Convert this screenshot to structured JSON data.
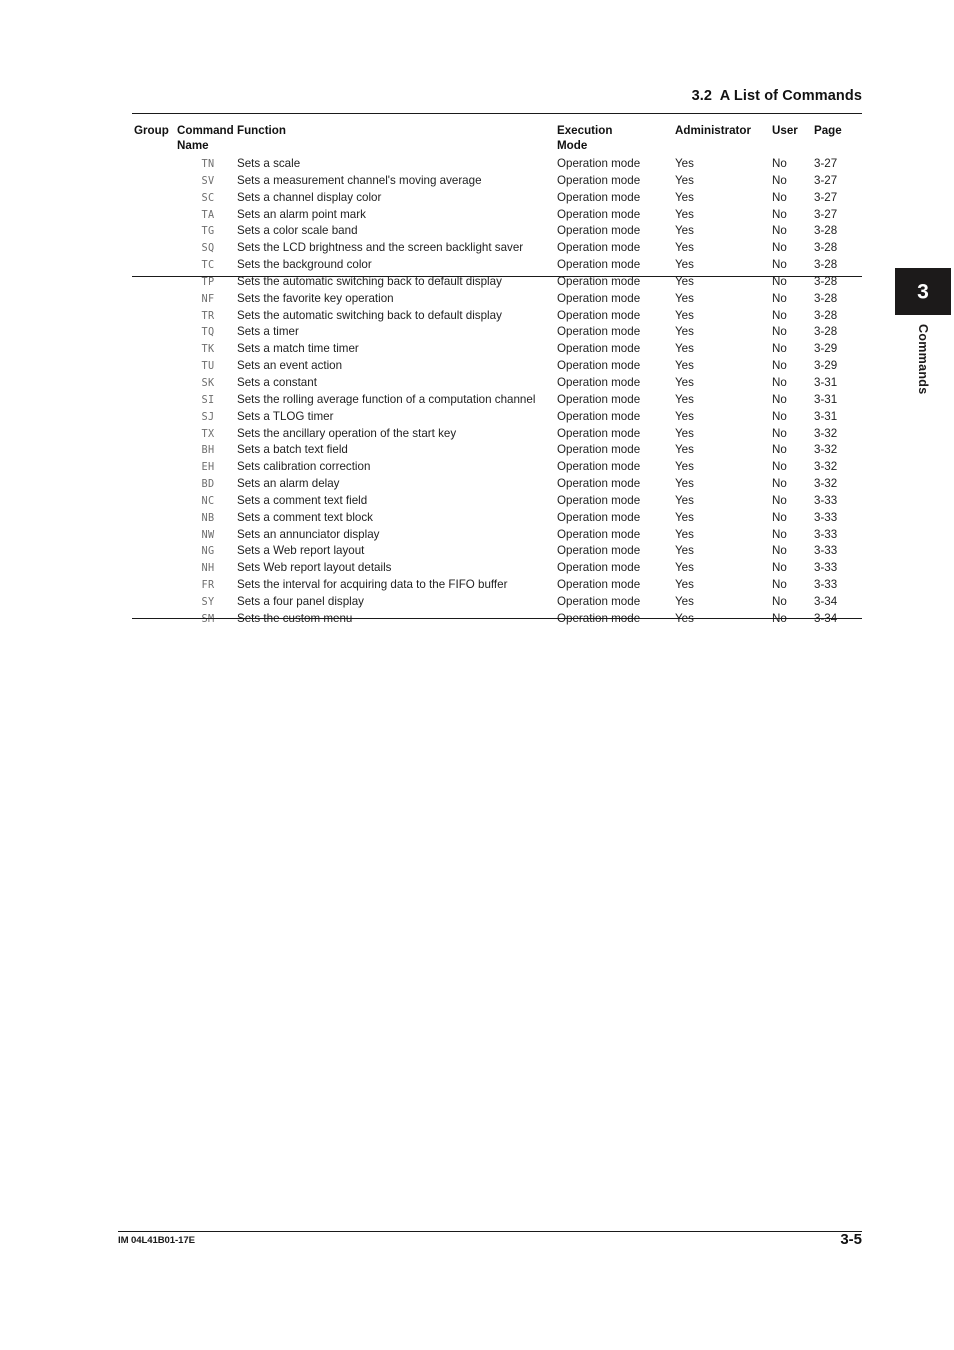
{
  "header": {
    "section_title": "3.2  A List of Commands"
  },
  "side_tab": {
    "number": "3",
    "label": "Commands",
    "box_color": "#1c1a1a"
  },
  "footer": {
    "document_code": "IM 04L41B01-17E",
    "page_number": "3-5"
  },
  "table": {
    "columns": {
      "group": "Group",
      "command_name_line1": "Command",
      "command_name_line2": "Name",
      "function": "Function",
      "execution_mode_line1": "Execution",
      "execution_mode_line2": "Mode",
      "administrator": "Administrator",
      "user": "User",
      "page": "Page"
    },
    "rows": [
      {
        "group": "",
        "command": "TN",
        "function": "Sets a scale",
        "exec": "Operation mode",
        "admin": "Yes",
        "user": "No",
        "page": "3-27"
      },
      {
        "group": "",
        "command": "SV",
        "function": "Sets a measurement channel's moving average",
        "exec": "Operation mode",
        "admin": "Yes",
        "user": "No",
        "page": "3-27"
      },
      {
        "group": "",
        "command": "SC",
        "function": "Sets a channel display color",
        "exec": "Operation mode",
        "admin": "Yes",
        "user": "No",
        "page": "3-27"
      },
      {
        "group": "",
        "command": "TA",
        "function": "Sets an alarm point mark",
        "exec": "Operation mode",
        "admin": "Yes",
        "user": "No",
        "page": "3-27"
      },
      {
        "group": "",
        "command": "TG",
        "function": "Sets a color scale band",
        "exec": "Operation mode",
        "admin": "Yes",
        "user": "No",
        "page": "3-28"
      },
      {
        "group": "",
        "command": "SQ",
        "function": "Sets the LCD brightness and the screen backlight saver",
        "exec": "Operation mode",
        "admin": "Yes",
        "user": "No",
        "page": "3-28"
      },
      {
        "group": "",
        "command": "TC",
        "function": "Sets the background color",
        "exec": "Operation mode",
        "admin": "Yes",
        "user": "No",
        "page": "3-28"
      },
      {
        "group": "",
        "command": "TP",
        "function": "Sets the automatic switching back to default display",
        "exec": "Operation mode",
        "admin": "Yes",
        "user": "No",
        "page": "3-28"
      },
      {
        "group": "",
        "command": "NF",
        "function": "Sets the favorite key operation",
        "exec": "Operation mode",
        "admin": "Yes",
        "user": "No",
        "page": "3-28"
      },
      {
        "group": "",
        "command": "TR",
        "function": "Sets the automatic switching back to default display",
        "exec": "Operation mode",
        "admin": "Yes",
        "user": "No",
        "page": "3-28"
      },
      {
        "group": "",
        "command": "TQ",
        "function": "Sets a timer",
        "exec": "Operation mode",
        "admin": "Yes",
        "user": "No",
        "page": "3-28"
      },
      {
        "group": "",
        "command": "TK",
        "function": "Sets a match time timer",
        "exec": "Operation mode",
        "admin": "Yes",
        "user": "No",
        "page": "3-29"
      },
      {
        "group": "",
        "command": "TU",
        "function": "Sets an event action",
        "exec": "Operation mode",
        "admin": "Yes",
        "user": "No",
        "page": "3-29"
      },
      {
        "group": "",
        "command": "SK",
        "function": "Sets a constant",
        "exec": "Operation mode",
        "admin": "Yes",
        "user": "No",
        "page": "3-31"
      },
      {
        "group": "",
        "command": "SI",
        "function": "Sets the rolling average function of a computation channel",
        "exec": "Operation mode",
        "admin": "Yes",
        "user": "No",
        "page": "3-31"
      },
      {
        "group": "",
        "command": "SJ",
        "function": "Sets a TLOG timer",
        "exec": "Operation mode",
        "admin": "Yes",
        "user": "No",
        "page": "3-31"
      },
      {
        "group": "",
        "command": "TX",
        "function": "Sets the ancillary operation of the start key",
        "exec": "Operation mode",
        "admin": "Yes",
        "user": "No",
        "page": "3-32"
      },
      {
        "group": "",
        "command": "BH",
        "function": "Sets a batch text field",
        "exec": "Operation mode",
        "admin": "Yes",
        "user": "No",
        "page": "3-32"
      },
      {
        "group": "",
        "command": "EH",
        "function": "Sets calibration correction",
        "exec": "Operation mode",
        "admin": "Yes",
        "user": "No",
        "page": "3-32"
      },
      {
        "group": "",
        "command": "BD",
        "function": "Sets an alarm delay",
        "exec": "Operation mode",
        "admin": "Yes",
        "user": "No",
        "page": "3-32"
      },
      {
        "group": "",
        "command": "NC",
        "function": "Sets a comment text field",
        "exec": "Operation mode",
        "admin": "Yes",
        "user": "No",
        "page": "3-33"
      },
      {
        "group": "",
        "command": "NB",
        "function": "Sets a comment text block",
        "exec": "Operation mode",
        "admin": "Yes",
        "user": "No",
        "page": "3-33"
      },
      {
        "group": "",
        "command": "NW",
        "function": "Sets an annunciator display",
        "exec": "Operation mode",
        "admin": "Yes",
        "user": "No",
        "page": "3-33"
      },
      {
        "group": "",
        "command": "NG",
        "function": "Sets a Web report layout",
        "exec": "Operation mode",
        "admin": "Yes",
        "user": "No",
        "page": "3-33"
      },
      {
        "group": "",
        "command": "NH",
        "function": "Sets Web report layout details",
        "exec": "Operation mode",
        "admin": "Yes",
        "user": "No",
        "page": "3-33"
      },
      {
        "group": "",
        "command": "FR",
        "function": "Sets the interval for acquiring data to the FIFO buffer",
        "exec": "Operation mode",
        "admin": "Yes",
        "user": "No",
        "page": "3-33"
      },
      {
        "group": "",
        "command": "SY",
        "function": "Sets a four panel display",
        "exec": "Operation mode",
        "admin": "Yes",
        "user": "No",
        "page": "3-34"
      },
      {
        "group": "",
        "command": "SM",
        "function": "Sets the custom menu",
        "exec": "Operation mode",
        "admin": "Yes",
        "user": "No",
        "page": "3-34"
      }
    ]
  }
}
